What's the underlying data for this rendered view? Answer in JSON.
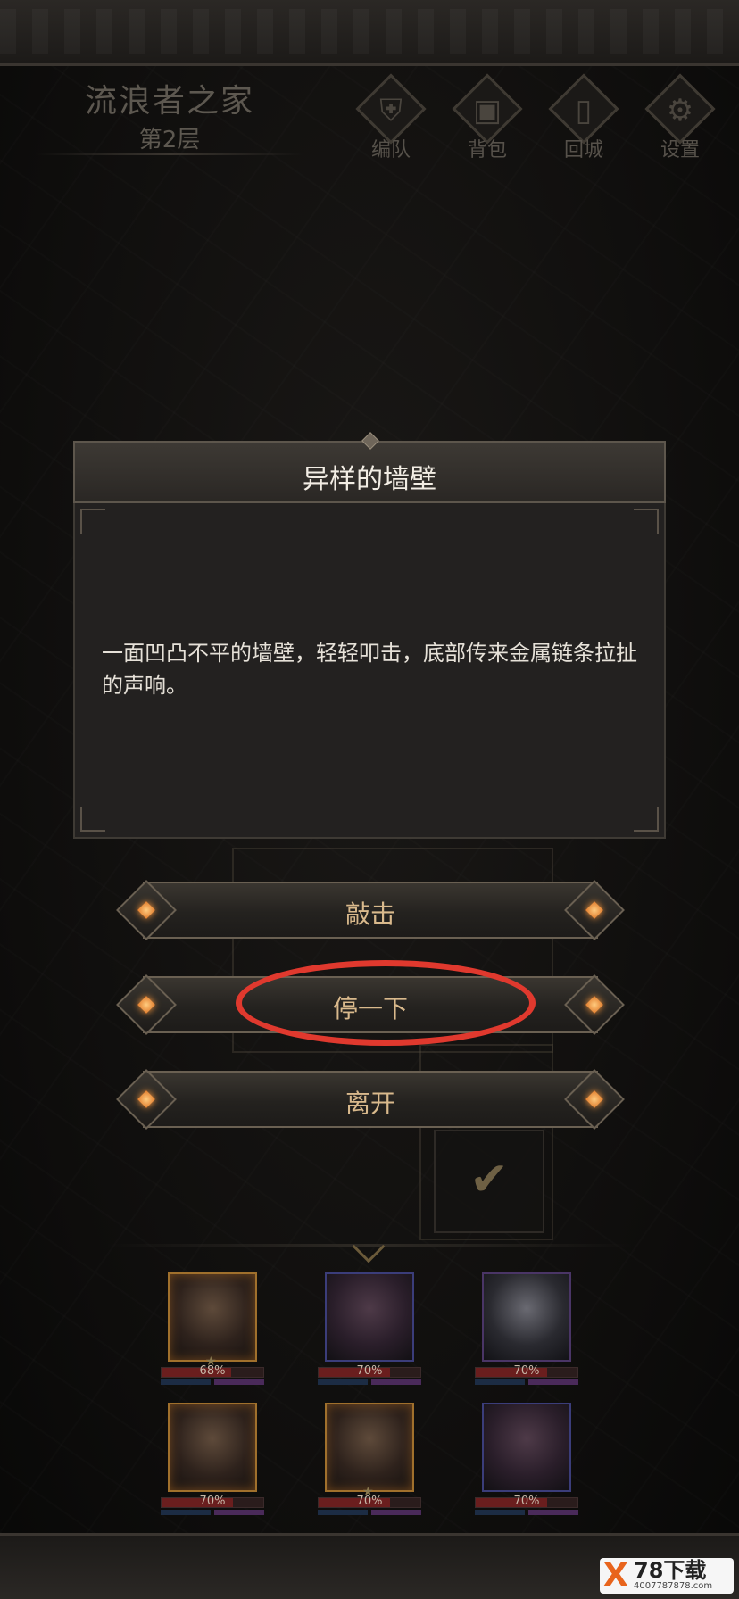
{
  "location": {
    "name": "流浪者之家",
    "floor": "第2层"
  },
  "menu": [
    {
      "label": "编队",
      "icon": "helmet-icon"
    },
    {
      "label": "背包",
      "icon": "backpack-icon"
    },
    {
      "label": "回城",
      "icon": "door-icon"
    },
    {
      "label": "设置",
      "icon": "gear-icon"
    }
  ],
  "dialog": {
    "title": "异样的墙壁",
    "text": "一面凹凸不平的墙壁，轻轻叩击，底部传来金属链条拉扯的声响。"
  },
  "choices": [
    {
      "label": "敲击"
    },
    {
      "label": "停一下",
      "highlighted": true
    },
    {
      "label": "离开"
    }
  ],
  "party": [
    {
      "hp_text": "68%",
      "hp": 0.68,
      "frame": "gold"
    },
    {
      "hp_text": "70%",
      "hp": 0.7,
      "frame": "blue"
    },
    {
      "hp_text": "70%",
      "hp": 0.7,
      "frame": "purple"
    },
    {
      "hp_text": "70%",
      "hp": 0.7,
      "frame": "gold"
    },
    {
      "hp_text": "70%",
      "hp": 0.7,
      "frame": "gold"
    },
    {
      "hp_text": "70%",
      "hp": 0.7,
      "frame": "blue"
    }
  ],
  "watermark": {
    "mark": "X",
    "text": "78下载",
    "sub": "4007787878.com"
  },
  "colors": {
    "accent_gold": "#d9b98c",
    "highlight_red": "#e0392e",
    "gem_orange": "#ff9a3c"
  }
}
